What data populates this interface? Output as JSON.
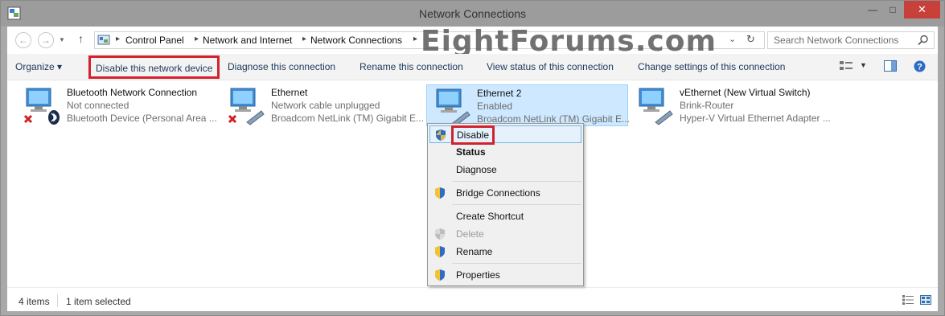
{
  "window": {
    "title": "Network Connections",
    "minimize": "—",
    "maximize": "□",
    "close": "✕"
  },
  "address": {
    "crumbs": [
      "Control Panel",
      "Network and Internet",
      "Network Connections"
    ],
    "search_placeholder": "Search Network Connections"
  },
  "watermark": "EightForums.com",
  "toolbar": {
    "organize": "Organize ▾",
    "disable": "Disable this network device",
    "diagnose": "Diagnose this connection",
    "rename": "Rename this connection",
    "status": "View status of this connection",
    "settings": "Change settings of this connection"
  },
  "items": [
    {
      "name": "Bluetooth Network Connection",
      "status": "Not connected",
      "device": "Bluetooth Device (Personal Area ...",
      "icon": "bluetooth-network-icon",
      "selected": false
    },
    {
      "name": "Ethernet",
      "status": "Network cable unplugged",
      "device": "Broadcom NetLink (TM) Gigabit E...",
      "icon": "ethernet-network-icon",
      "selected": false
    },
    {
      "name": "Ethernet 2",
      "status": "Enabled",
      "device": "Broadcom NetLink (TM) Gigabit E...",
      "icon": "ethernet-network-icon",
      "selected": true
    },
    {
      "name": "vEthernet (New Virtual Switch)",
      "status": "Brink-Router",
      "device": "Hyper-V Virtual Ethernet Adapter ...",
      "icon": "virtual-ethernet-icon",
      "selected": false
    }
  ],
  "context_menu": {
    "disable": "Disable",
    "status": "Status",
    "diagnose": "Diagnose",
    "bridge": "Bridge Connections",
    "shortcut": "Create Shortcut",
    "delete": "Delete",
    "rename": "Rename",
    "properties": "Properties"
  },
  "statusbar": {
    "count": "4 items",
    "selected": "1 item selected"
  },
  "colors": {
    "highlight_red": "#d3212d",
    "selection": "#cde8ff",
    "link": "#1e395b"
  }
}
